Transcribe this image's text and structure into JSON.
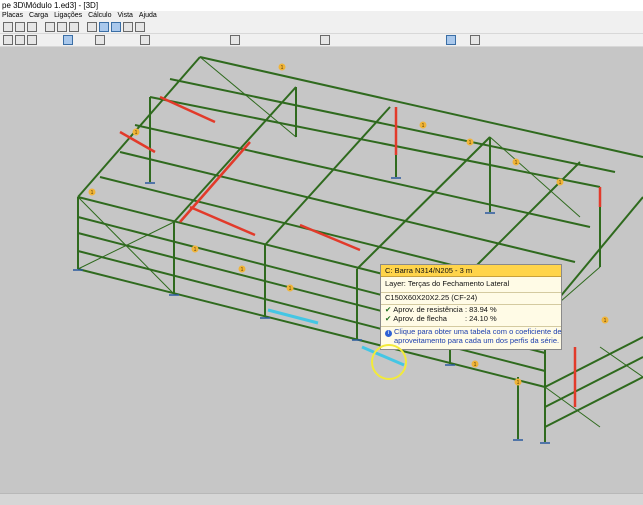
{
  "window": {
    "title": "pe 3D\\Módulo 1.ed3] - [3D]"
  },
  "menu": [
    "Placas",
    "Carga",
    "Ligações",
    "Cálculo",
    "Vista",
    "Ajuda"
  ],
  "toolbar_icons": [
    "new",
    "open",
    "save",
    "zoom",
    "pan",
    "rotate",
    "select",
    "grid",
    "axes",
    "layers",
    "measure",
    "bars",
    "nodes",
    "supports",
    "loads",
    "sections",
    "render",
    "hide",
    "show",
    "colors",
    "settings"
  ],
  "tooltip": {
    "header": "C: Barra N314/N205 - 3 m",
    "layer_label": "Layer",
    "layer_value": "Terças do Fechamento Lateral",
    "profile": "C150X60X20X2.25 (CF-24)",
    "resistance_label": "Aprov. de resistência",
    "resistance_value": ": 83.94 %",
    "deflection_label": "Aprov. de flecha",
    "deflection_value": ": 24.10 %",
    "info_line1": "Clique para obter uma tabela com o coeficiente de",
    "info_line2": "aproveitamento para cada um dos perfis da série."
  },
  "colors": {
    "member": "#2f6a1e",
    "highlight": "#e23a2a",
    "selected": "#44c6e4",
    "background": "#c6c6c6",
    "node_badge": "#f0b438"
  },
  "node_badge_label": "1"
}
